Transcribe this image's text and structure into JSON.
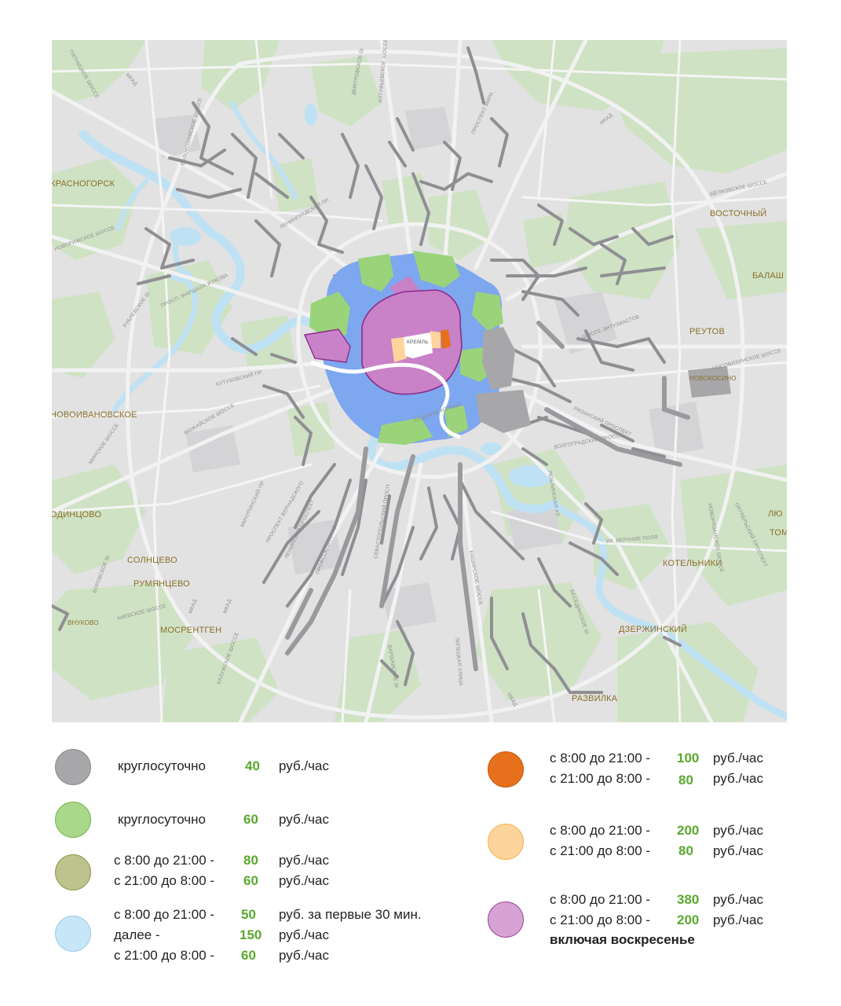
{
  "map": {
    "places": [
      {
        "id": "krasnogorsk",
        "label": "КРАСНОГОРСК"
      },
      {
        "id": "vostochny",
        "label": "ВОСТОЧНЫЙ"
      },
      {
        "id": "balash",
        "label": "БАЛАШ"
      },
      {
        "id": "reutov",
        "label": "РЕУТОВ"
      },
      {
        "id": "novokosino",
        "label": "НОВОКОСИНО"
      },
      {
        "id": "novoivanovskoe",
        "label": "НОВОИВАНОВСКОЕ"
      },
      {
        "id": "odintsovo",
        "label": "ОДИНЦОВО"
      },
      {
        "id": "solntsevo",
        "label": "СОЛНЦЕВО"
      },
      {
        "id": "rumyantsevo",
        "label": "РУМЯНЦЕВО"
      },
      {
        "id": "vnukovo",
        "label": "ВНУКОВО"
      },
      {
        "id": "mosrentgen",
        "label": "МОСРЕНТГЕН"
      },
      {
        "id": "kotelniki",
        "label": "КОТЕЛЬНИКИ"
      },
      {
        "id": "dzerzhinsky",
        "label": "ДЗЕРЖИНСКИЙ"
      },
      {
        "id": "razvilka",
        "label": "РАЗВИЛКА"
      },
      {
        "id": "lyu",
        "label": "ЛЮ"
      },
      {
        "id": "tom",
        "label": "ТОМ"
      },
      {
        "id": "kreml",
        "label": "КРЕМЛЬ"
      }
    ],
    "roads": [
      {
        "id": "pyatnitskoe",
        "label": "ПЯТНИЦКОЕ ШОССЕ"
      },
      {
        "id": "mkad_nw",
        "label": "МКАД"
      },
      {
        "id": "dmitrovskoe",
        "label": "ДМИТРОВСКОЕ Ш."
      },
      {
        "id": "altufevskoe",
        "label": "АЛТУФЬЕВСКОЕ ШОССЕ"
      },
      {
        "id": "mira",
        "label": "ПРОСПЕКТ МИРА"
      },
      {
        "id": "mkad_ne",
        "label": "МКАД"
      },
      {
        "id": "shchelkovskoe",
        "label": "ЩЁЛКОВСКОЕ ШОССЕ"
      },
      {
        "id": "volokolamskoe",
        "label": "ВОЛОКОЛАМСКОЕ ШОССЕ"
      },
      {
        "id": "novorizhskoe",
        "label": "НОВОРИЖСКОЕ ШОССЕ"
      },
      {
        "id": "leningradsky",
        "label": "ЛЕНИНГРАДСКИЙ ПР."
      },
      {
        "id": "marshala",
        "label": "ПРОСП. МАРШАЛА ЖУКОВА"
      },
      {
        "id": "rublevskoe",
        "label": "РУБЛЕВСКОЕ Ш."
      },
      {
        "id": "entuziastov",
        "label": "ШОССЕ ЭНТУЗИАСТОВ"
      },
      {
        "id": "nosovikhinskoe",
        "label": "НОСОВИХИНСКОЕ ШОССЕ"
      },
      {
        "id": "kutuzovsky",
        "label": "КУТУЗОВСКИЙ ПР."
      },
      {
        "id": "mozhayskoe",
        "label": "МОЖАЙСКОЕ ШОССЕ"
      },
      {
        "id": "minskoe",
        "label": "МИНСКОЕ ШОССЕ"
      },
      {
        "id": "ryazansky",
        "label": "РЯЗАНСКИЙ ПРОСПЕКТ"
      },
      {
        "id": "volgogradsky",
        "label": "ВОЛГОГРАДСКИЙ ПРОСП."
      },
      {
        "id": "michurinsky",
        "label": "МИЧУРИНСКИЙ ПР."
      },
      {
        "id": "vernadskogo",
        "label": "ПРОСПЕКТ ВЕРНАДСКОГО"
      },
      {
        "id": "leninsky",
        "label": "ЛЕНИНСКИЙ ПРОСПЕКТ"
      },
      {
        "id": "profsoyuznaya",
        "label": "ПРОФСОЮЗНАЯ УЛ."
      },
      {
        "id": "sevastopolsky",
        "label": "СЕВАСТОПОЛЬСКИЙ ПРОСП."
      },
      {
        "id": "lyublinskaya",
        "label": "ЛЮБЛИНСКАЯ УЛ."
      },
      {
        "id": "verkhnie",
        "label": "УЛ. ВЕРХНИЕ ПОЛЯ"
      },
      {
        "id": "novoryazanskoe",
        "label": "НОВОРЯЗАНСКОЕ ШОССЕ"
      },
      {
        "id": "oktyabrsky",
        "label": "ОКТЯБРЬСКИЙ ПРОСПЕКТ"
      },
      {
        "id": "borovskoe",
        "label": "БОРОВСКОЕ Ш."
      },
      {
        "id": "kievskoe",
        "label": "КИЕВСКОЕ ШОССЕ"
      },
      {
        "id": "mkad_sw",
        "label": "МКАД"
      },
      {
        "id": "kashirskoe",
        "label": "КАШИРСКОЕ ШОССЕ"
      },
      {
        "id": "besedinskoe",
        "label": "БЕСЕДИНСКОЕ Ш."
      },
      {
        "id": "kaluzhskoe",
        "label": "КАЛУЖСКОЕ ШОССЕ"
      },
      {
        "id": "varshavskoe",
        "label": "ВАРШАВСКОЕ Ш."
      },
      {
        "id": "lipetskaya",
        "label": "ЛИПЕЦКАЯ УЛИЦА"
      },
      {
        "id": "mkad_s",
        "label": "МКАД"
      },
      {
        "id": "sadovoe",
        "label": "САДОВОЕ КОЛЬЦО"
      },
      {
        "id": "mkad_w",
        "label": "МКАД"
      }
    ]
  },
  "legend": {
    "colors": {
      "gray": "#a7a7aa",
      "green": "#a9d88a",
      "olive": "#bec28c",
      "blue": "#c7e6f7",
      "orange": "#e6701c",
      "peach": "#fdd49b",
      "purple": "#d7a2d4",
      "price": "#5aa82e"
    },
    "items": [
      {
        "id": "gray",
        "lines": [
          {
            "text": "круглосуточно",
            "price": "40",
            "unit": "руб./час"
          }
        ]
      },
      {
        "id": "green",
        "lines": [
          {
            "text": "круглосуточно",
            "price": "60",
            "unit": "руб./час"
          }
        ]
      },
      {
        "id": "olive",
        "lines": [
          {
            "text": "с 8:00 до 21:00 -",
            "price": "80",
            "unit": "руб./час"
          },
          {
            "text": "с 21:00 до 8:00 -",
            "price": "60",
            "unit": "руб./час"
          }
        ]
      },
      {
        "id": "blue",
        "lines": [
          {
            "text": "с 8:00 до 21:00 -",
            "price": "50",
            "unit": "руб. за первые 30 мин."
          },
          {
            "text": "далее -",
            "price": "150",
            "unit": "руб./час"
          },
          {
            "text": "с 21:00 до 8:00 -",
            "price": "60",
            "unit": "руб./час"
          }
        ]
      },
      {
        "id": "orange",
        "lines": [
          {
            "text": "с 8:00 до 21:00 -",
            "price": "100",
            "unit": "руб./час"
          },
          {
            "text": "с 21:00 до 8:00 -",
            "price": "80",
            "unit": "руб./час"
          }
        ]
      },
      {
        "id": "peach",
        "lines": [
          {
            "text": "с 8:00 до 21:00 -",
            "price": "200",
            "unit": "руб./час"
          },
          {
            "text": "с 21:00 до 8:00 -",
            "price": "80",
            "unit": "руб./час"
          }
        ]
      },
      {
        "id": "purple",
        "lines": [
          {
            "text": "с 8:00 до 21:00 -",
            "price": "380",
            "unit": "руб./час"
          },
          {
            "text": "с 21:00 до 8:00 -",
            "price": "200",
            "unit": "руб./час"
          }
        ],
        "note": "включая воскресенье"
      }
    ]
  }
}
